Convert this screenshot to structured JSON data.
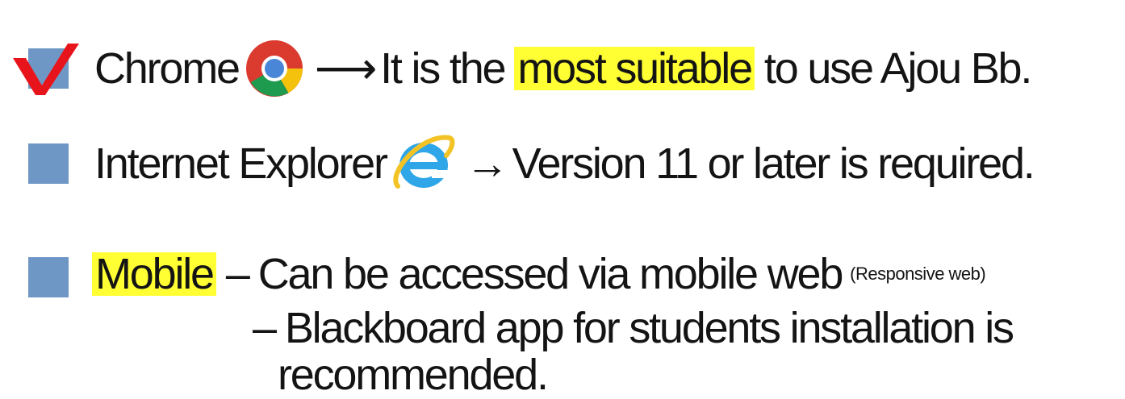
{
  "line1": {
    "browser": "Chrome",
    "arrow": "⟶",
    "pre": "It is the",
    "highlight": "most suitable",
    "post": "to use Ajou Bb.",
    "icon": "chrome-icon"
  },
  "line2": {
    "browser": "Internet Explorer",
    "arrow": "→",
    "text": "Version 11 or later is required.",
    "icon": "internet-explorer-icon"
  },
  "line3": {
    "label": "Mobile",
    "dash": "–",
    "text": "Can be accessed via mobile web",
    "note": "(Responsive web)",
    "sub_dash": "–",
    "sub_text": "Blackboard app for students installation is",
    "sub_text2": "recommended."
  },
  "colors": {
    "bullet": "#6f97c5",
    "highlight": "#ffff33",
    "check": "#e8141c"
  }
}
